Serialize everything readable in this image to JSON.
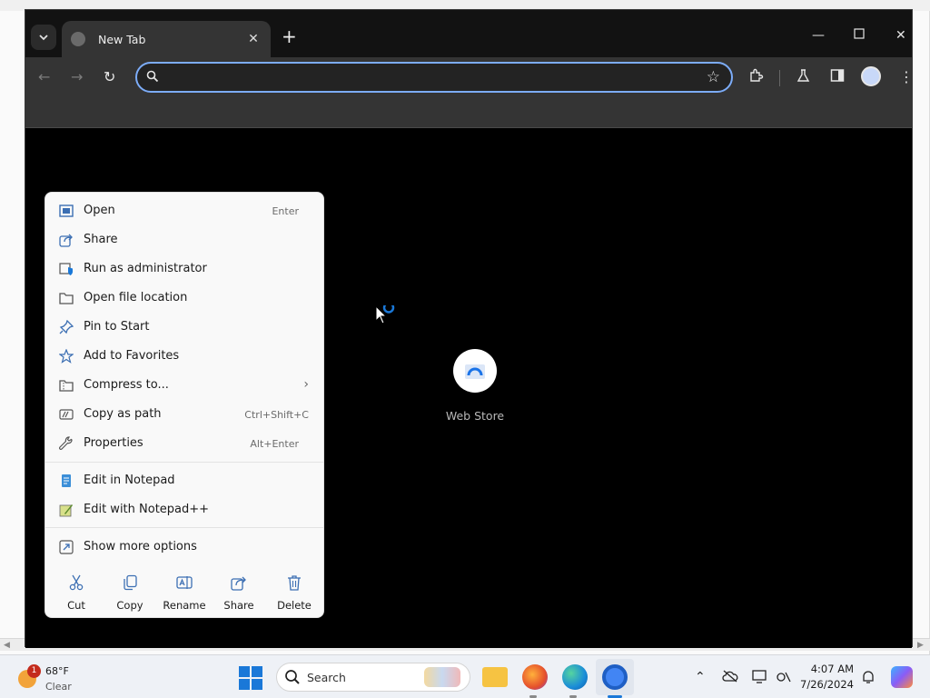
{
  "browser": {
    "tab_title": "New Tab",
    "omnibox_placeholder": "",
    "shortcut_label": "Web Store"
  },
  "context_menu": {
    "items": [
      {
        "label": "Open",
        "shortcut": "Enter",
        "icon": "open-icon"
      },
      {
        "label": "Share",
        "shortcut": "",
        "icon": "share-icon"
      },
      {
        "label": "Run as administrator",
        "shortcut": "",
        "icon": "shield-icon"
      },
      {
        "label": "Open file location",
        "shortcut": "",
        "icon": "folder-icon"
      },
      {
        "label": "Pin to Start",
        "shortcut": "",
        "icon": "pin-icon"
      },
      {
        "label": "Add to Favorites",
        "shortcut": "",
        "icon": "star-icon"
      },
      {
        "label": "Compress to...",
        "shortcut": "",
        "icon": "zip-icon"
      },
      {
        "label": "Copy as path",
        "shortcut": "Ctrl+Shift+C",
        "icon": "path-icon"
      },
      {
        "label": "Properties",
        "shortcut": "Alt+Enter",
        "icon": "wrench-icon"
      },
      {
        "label": "Edit in Notepad",
        "shortcut": "",
        "icon": "notepad-icon"
      },
      {
        "label": "Edit with Notepad++",
        "shortcut": "",
        "icon": "notepadpp-icon"
      },
      {
        "label": "Show more options",
        "shortcut": "",
        "icon": "more-options-icon"
      }
    ],
    "actions": [
      {
        "label": "Cut",
        "icon": "scissors-icon"
      },
      {
        "label": "Copy",
        "icon": "copy-icon"
      },
      {
        "label": "Rename",
        "icon": "rename-icon"
      },
      {
        "label": "Share",
        "icon": "share-icon"
      },
      {
        "label": "Delete",
        "icon": "trash-icon"
      }
    ]
  },
  "taskbar": {
    "weather_badge": "1",
    "weather_temp": "68°F",
    "weather_condition": "Clear",
    "search_label": "Search",
    "time": "4:07 AM",
    "date": "7/26/2024"
  },
  "colors": {
    "omnibox_focus": "#7cacf8",
    "windows_accent": "#1a78d8",
    "notification_badge": "#c42b1c"
  }
}
